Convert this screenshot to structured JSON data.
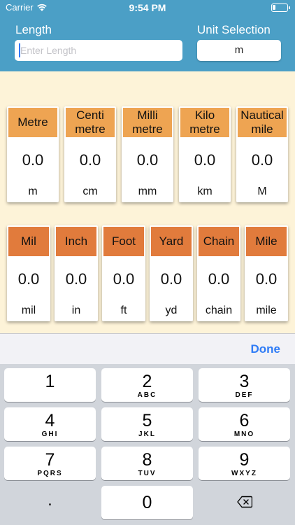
{
  "status": {
    "carrier": "Carrier",
    "time": "9:54 PM"
  },
  "header": {
    "length_label": "Length",
    "length_placeholder": "Enter Length",
    "unit_label": "Unit Selection",
    "unit_value": "m"
  },
  "row1": [
    {
      "name": "Metre",
      "value": "0.0",
      "abbr": "m"
    },
    {
      "name": "Centi\nmetre",
      "value": "0.0",
      "abbr": "cm"
    },
    {
      "name": "Milli\nmetre",
      "value": "0.0",
      "abbr": "mm"
    },
    {
      "name": "Kilo\nmetre",
      "value": "0.0",
      "abbr": "km"
    },
    {
      "name": "Nautical\nmile",
      "value": "0.0",
      "abbr": "M"
    }
  ],
  "row2": [
    {
      "name": "Mil",
      "value": "0.0",
      "abbr": "mil"
    },
    {
      "name": "Inch",
      "value": "0.0",
      "abbr": "in"
    },
    {
      "name": "Foot",
      "value": "0.0",
      "abbr": "ft"
    },
    {
      "name": "Yard",
      "value": "0.0",
      "abbr": "yd"
    },
    {
      "name": "Chain",
      "value": "0.0",
      "abbr": "chain"
    },
    {
      "name": "Mile",
      "value": "0.0",
      "abbr": "mile"
    }
  ],
  "keyboard": {
    "done_label": "Done",
    "keys": [
      {
        "num": "1",
        "letters": ""
      },
      {
        "num": "2",
        "letters": "ABC"
      },
      {
        "num": "3",
        "letters": "DEF"
      },
      {
        "num": "4",
        "letters": "GHI"
      },
      {
        "num": "5",
        "letters": "JKL"
      },
      {
        "num": "6",
        "letters": "MNO"
      },
      {
        "num": "7",
        "letters": "PQRS"
      },
      {
        "num": "8",
        "letters": "TUV"
      },
      {
        "num": "9",
        "letters": "WXYZ"
      }
    ],
    "dot": ".",
    "zero": "0",
    "delete_icon": "delete-backspace-icon"
  },
  "colors": {
    "header_bg": "#4b9fc6",
    "content_bg": "#fdf3d8",
    "row1_head": "#eea452",
    "row2_head": "#e17b3c",
    "done": "#2f7cf6"
  }
}
